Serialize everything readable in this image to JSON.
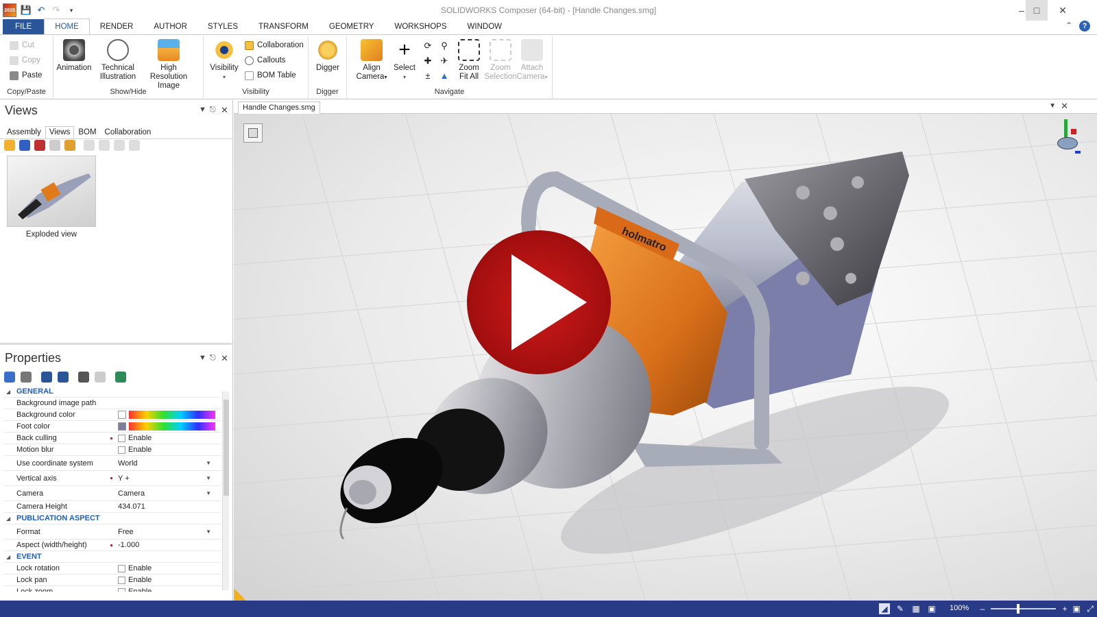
{
  "app": {
    "title": "SOLIDWORKS Composer (64-bit) - [Handle Changes.smg]",
    "icon_text": "2015"
  },
  "ribbon_tabs": [
    "FILE",
    "HOME",
    "RENDER",
    "AUTHOR",
    "STYLES",
    "TRANSFORM",
    "GEOMETRY",
    "WORKSHOPS",
    "WINDOW"
  ],
  "active_tab": "HOME",
  "groups": {
    "copy_paste": {
      "label": "Copy/Paste",
      "cut": "Cut",
      "copy": "Copy",
      "paste": "Paste"
    },
    "show_hide": {
      "label": "Show/Hide",
      "animation": "Animation",
      "technical_1": "Technical",
      "technical_2": "Illustration",
      "hires_1": "High Resolution",
      "hires_2": "Image"
    },
    "visibility": {
      "label": "Visibility",
      "visibility": "Visibility",
      "collaboration": "Collaboration",
      "callouts": "Callouts",
      "bom_table": "BOM Table"
    },
    "digger": {
      "label": "Digger",
      "digger": "Digger"
    },
    "navigate": {
      "label": "Navigate",
      "align_1": "Align",
      "align_2": "Camera",
      "select": "Select",
      "zoomfit_1": "Zoom",
      "zoomfit_2": "Fit All",
      "zoomsel_1": "Zoom",
      "zoomsel_2": "Selection",
      "attach_1": "Attach",
      "attach_2": "Camera"
    }
  },
  "views_panel": {
    "title": "Views",
    "tabs": [
      "Assembly",
      "Views",
      "BOM",
      "Collaboration"
    ],
    "active_tab": "Views",
    "thumbnail_label": "Exploded view"
  },
  "properties_panel": {
    "title": "Properties",
    "rows": [
      {
        "type": "section",
        "label": "GENERAL"
      },
      {
        "key": "Background image path",
        "kind": "text",
        "value": ""
      },
      {
        "key": "Background color",
        "kind": "color",
        "swatch": "#ffffff"
      },
      {
        "key": "Foot color",
        "kind": "color",
        "swatch": "#7c7c9c"
      },
      {
        "key": "Back culling",
        "kind": "check",
        "value": "Enable",
        "flag": true
      },
      {
        "key": "Motion blur",
        "kind": "check",
        "value": "Enable"
      },
      {
        "key": "Use coordinate system",
        "kind": "dropdown",
        "value": "World"
      },
      {
        "key": "Vertical axis",
        "kind": "dropdown",
        "value": "Y +",
        "flag": true
      },
      {
        "key": "Camera",
        "kind": "dropdown",
        "value": "Camera"
      },
      {
        "key": "Camera Height",
        "kind": "text",
        "value": "434.071"
      },
      {
        "type": "section",
        "label": "PUBLICATION ASPECT"
      },
      {
        "key": "Format",
        "kind": "dropdown",
        "value": "Free"
      },
      {
        "key": "Aspect (width/height)",
        "kind": "text",
        "value": "-1.000",
        "flag": true
      },
      {
        "type": "section",
        "label": "EVENT"
      },
      {
        "key": "Lock rotation",
        "kind": "check",
        "value": "Enable"
      },
      {
        "key": "Lock pan",
        "kind": "check",
        "value": "Enable"
      },
      {
        "key": "Lock zoom",
        "kind": "check",
        "value": "Enable"
      }
    ]
  },
  "document": {
    "tab": "Handle Changes.smg",
    "brand_text": "holmatro"
  },
  "status": {
    "zoom": "100%"
  },
  "colors": {
    "accent": "#2a5699",
    "status_bar": "#293a86",
    "play_button": "#c01818",
    "orange_body": "#e07a1a"
  }
}
